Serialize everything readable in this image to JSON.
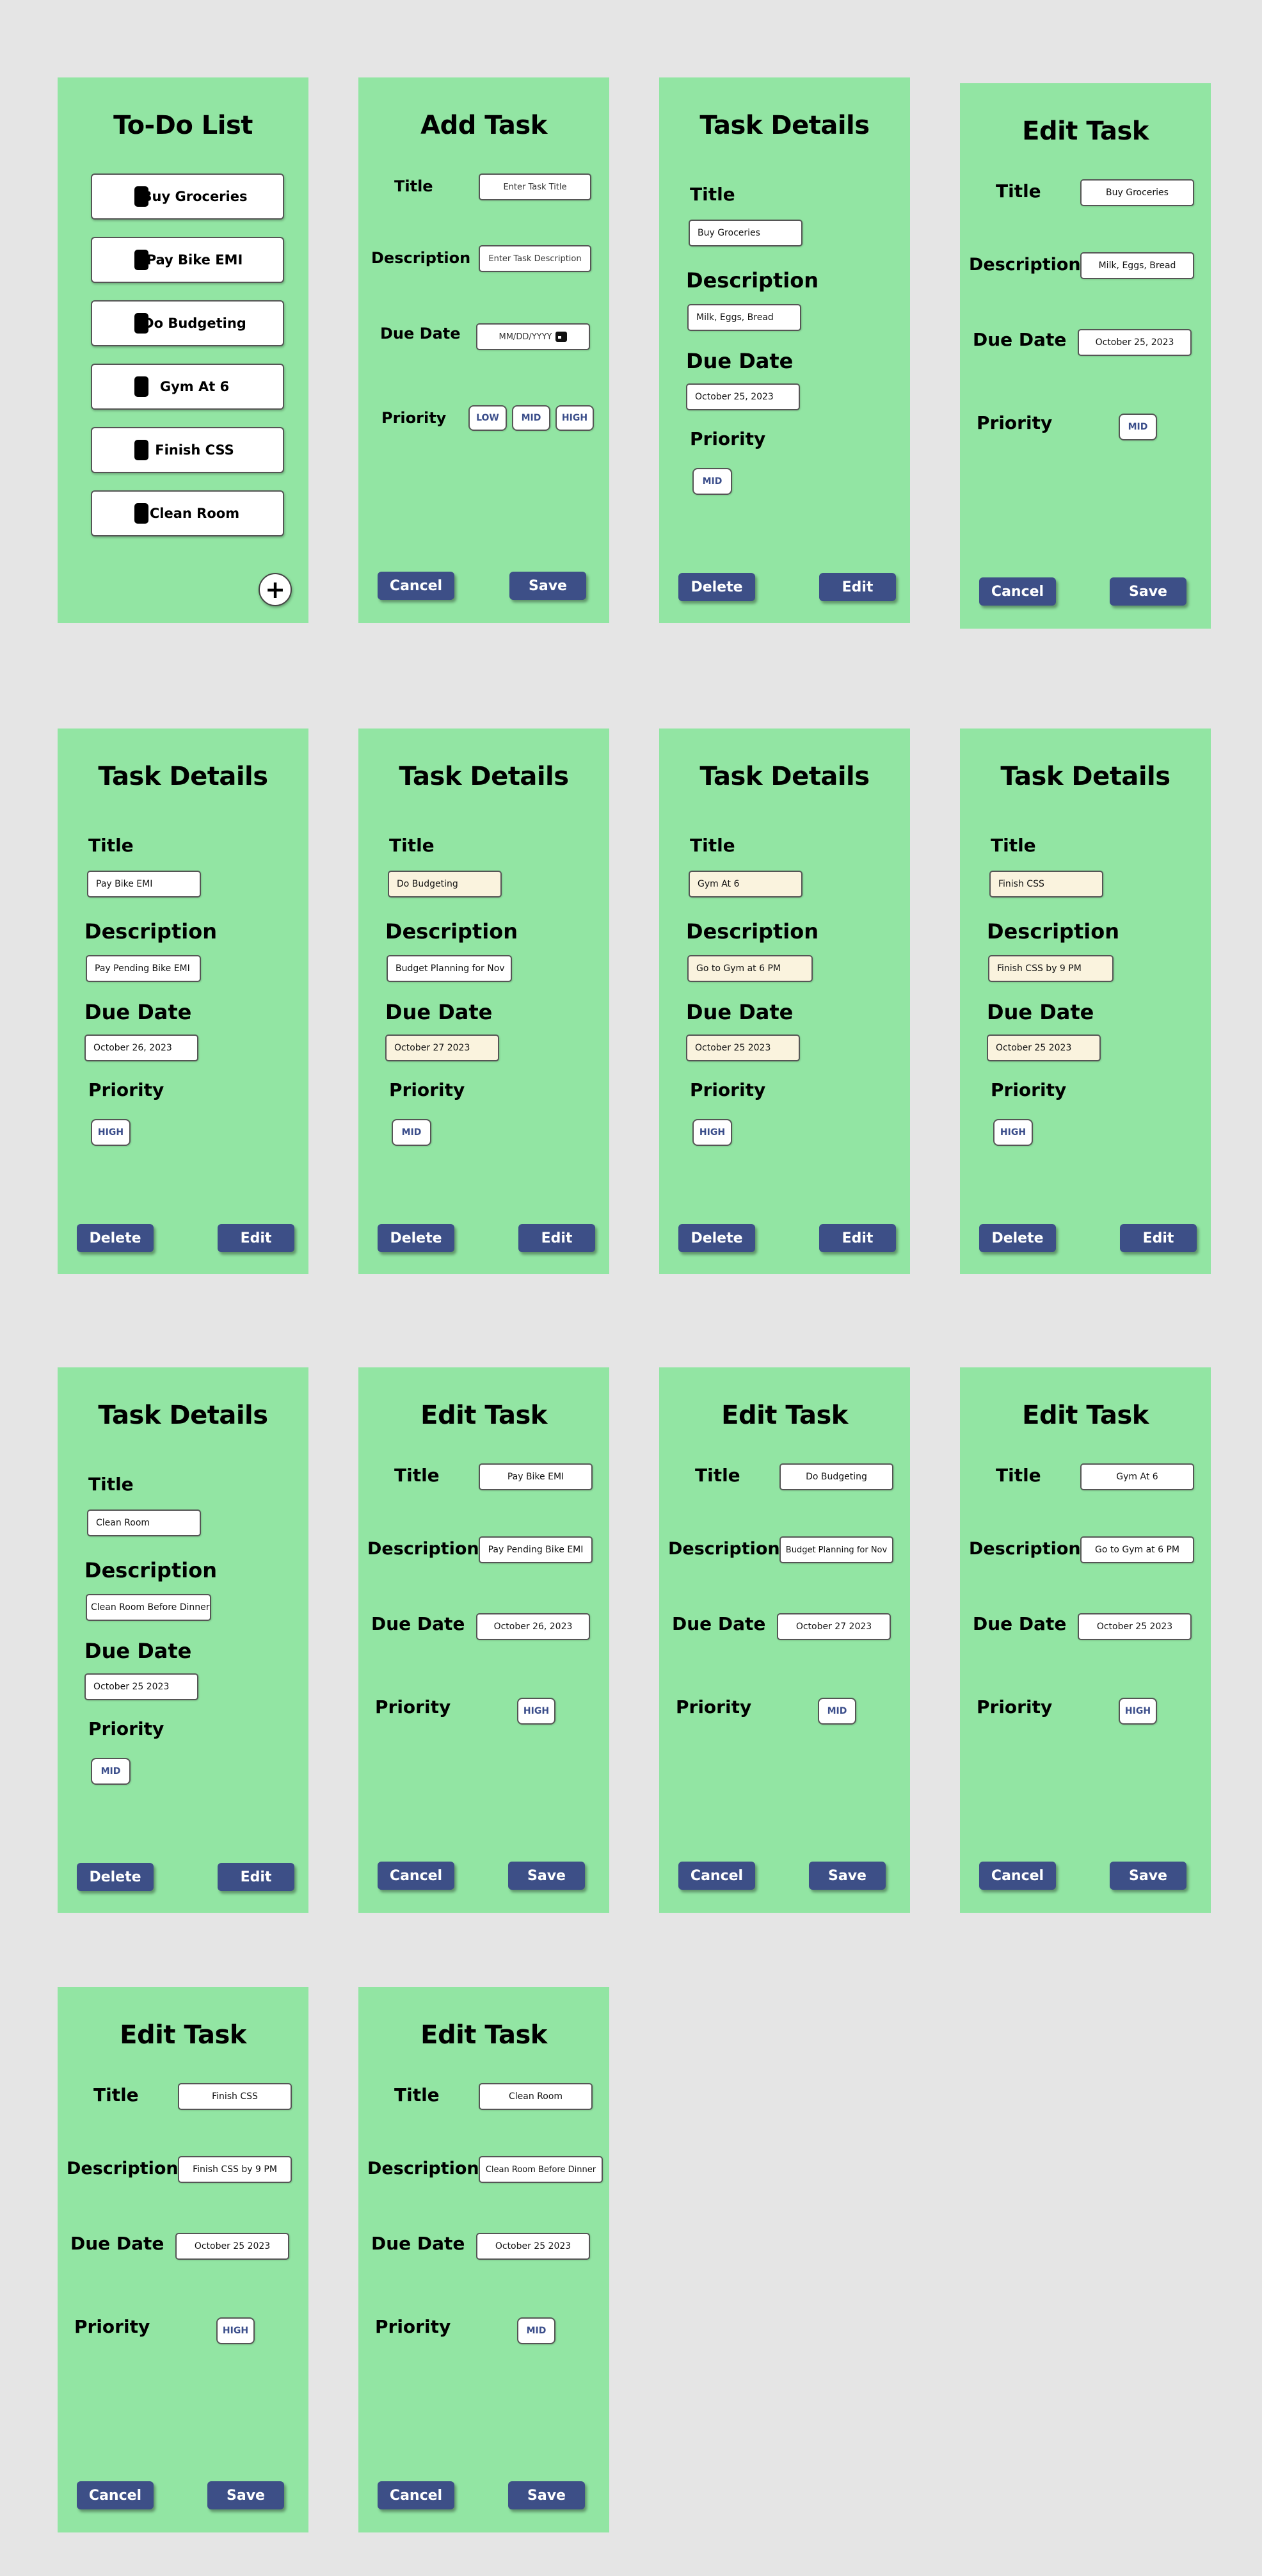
{
  "todo": {
    "title": "To-Do List",
    "items": [
      "Buy Groceries",
      "Pay Bike EMI",
      "Do Budgeting",
      "Gym At 6",
      "Finish CSS",
      "Clean Room"
    ],
    "add_symbol": "+"
  },
  "add_task": {
    "title": "Add Task",
    "title_label": "Title",
    "title_placeholder": "Enter Task Title",
    "description_label": "Description",
    "description_placeholder": "Enter Task Description",
    "due_label": "Due Date",
    "due_placeholder": "MM/DD/YYYY",
    "priority_label": "Priority",
    "priorities": [
      "LOW",
      "MID",
      "HIGH"
    ],
    "cancel": "Cancel",
    "save": "Save"
  },
  "labels": {
    "details_title": "Task Details",
    "edit_title": "Edit Task",
    "title": "Title",
    "description": "Description",
    "due_date": "Due Date",
    "priority": "Priority",
    "delete": "Delete",
    "edit": "Edit",
    "cancel": "Cancel",
    "save": "Save"
  },
  "details": [
    {
      "title": "Buy Groceries",
      "description": "Milk, Eggs, Bread",
      "due": "October 25, 2023",
      "priority": "MID"
    },
    {
      "title": "Pay Bike EMI",
      "description": "Pay Pending Bike EMI",
      "due": "October 26, 2023",
      "priority": "HIGH"
    },
    {
      "title": "Do Budgeting",
      "description": "Budget Planning for Nov",
      "due": "October 27 2023",
      "priority": "MID"
    },
    {
      "title": "Gym At 6",
      "description": "Go to Gym at 6 PM",
      "due": "October 25 2023",
      "priority": "HIGH"
    },
    {
      "title": "Finish CSS",
      "description": "Finish CSS by 9 PM",
      "due": "October 25 2023",
      "priority": "HIGH"
    },
    {
      "title": "Clean Room",
      "description": "Clean Room Before Dinner",
      "due": "October 25 2023",
      "priority": "MID"
    }
  ],
  "edits": [
    {
      "title": "Buy Groceries",
      "description": "Milk, Eggs, Bread",
      "due": "October 25, 2023",
      "priority": "MID"
    },
    {
      "title": "Pay Bike EMI",
      "description": "Pay Pending Bike EMI",
      "due": "October 26, 2023",
      "priority": "HIGH"
    },
    {
      "title": "Do Budgeting",
      "description": "Budget Planning for Nov",
      "due": "October 27 2023",
      "priority": "MID"
    },
    {
      "title": "Gym At 6",
      "description": "Go to Gym at 6 PM",
      "due": "October 25 2023",
      "priority": "HIGH"
    },
    {
      "title": "Finish CSS",
      "description": "Finish CSS by 9 PM",
      "due": "October 25 2023",
      "priority": "HIGH"
    },
    {
      "title": "Clean Room",
      "description": "Clean Room Before Dinner",
      "due": "October 25 2023",
      "priority": "MID"
    }
  ],
  "colors": {
    "background": "#e5e5e5",
    "screen": "#92e5a3",
    "button": "#3d4f87",
    "chip_text": "#3a4d8a",
    "cream_field": "#faf3de"
  }
}
